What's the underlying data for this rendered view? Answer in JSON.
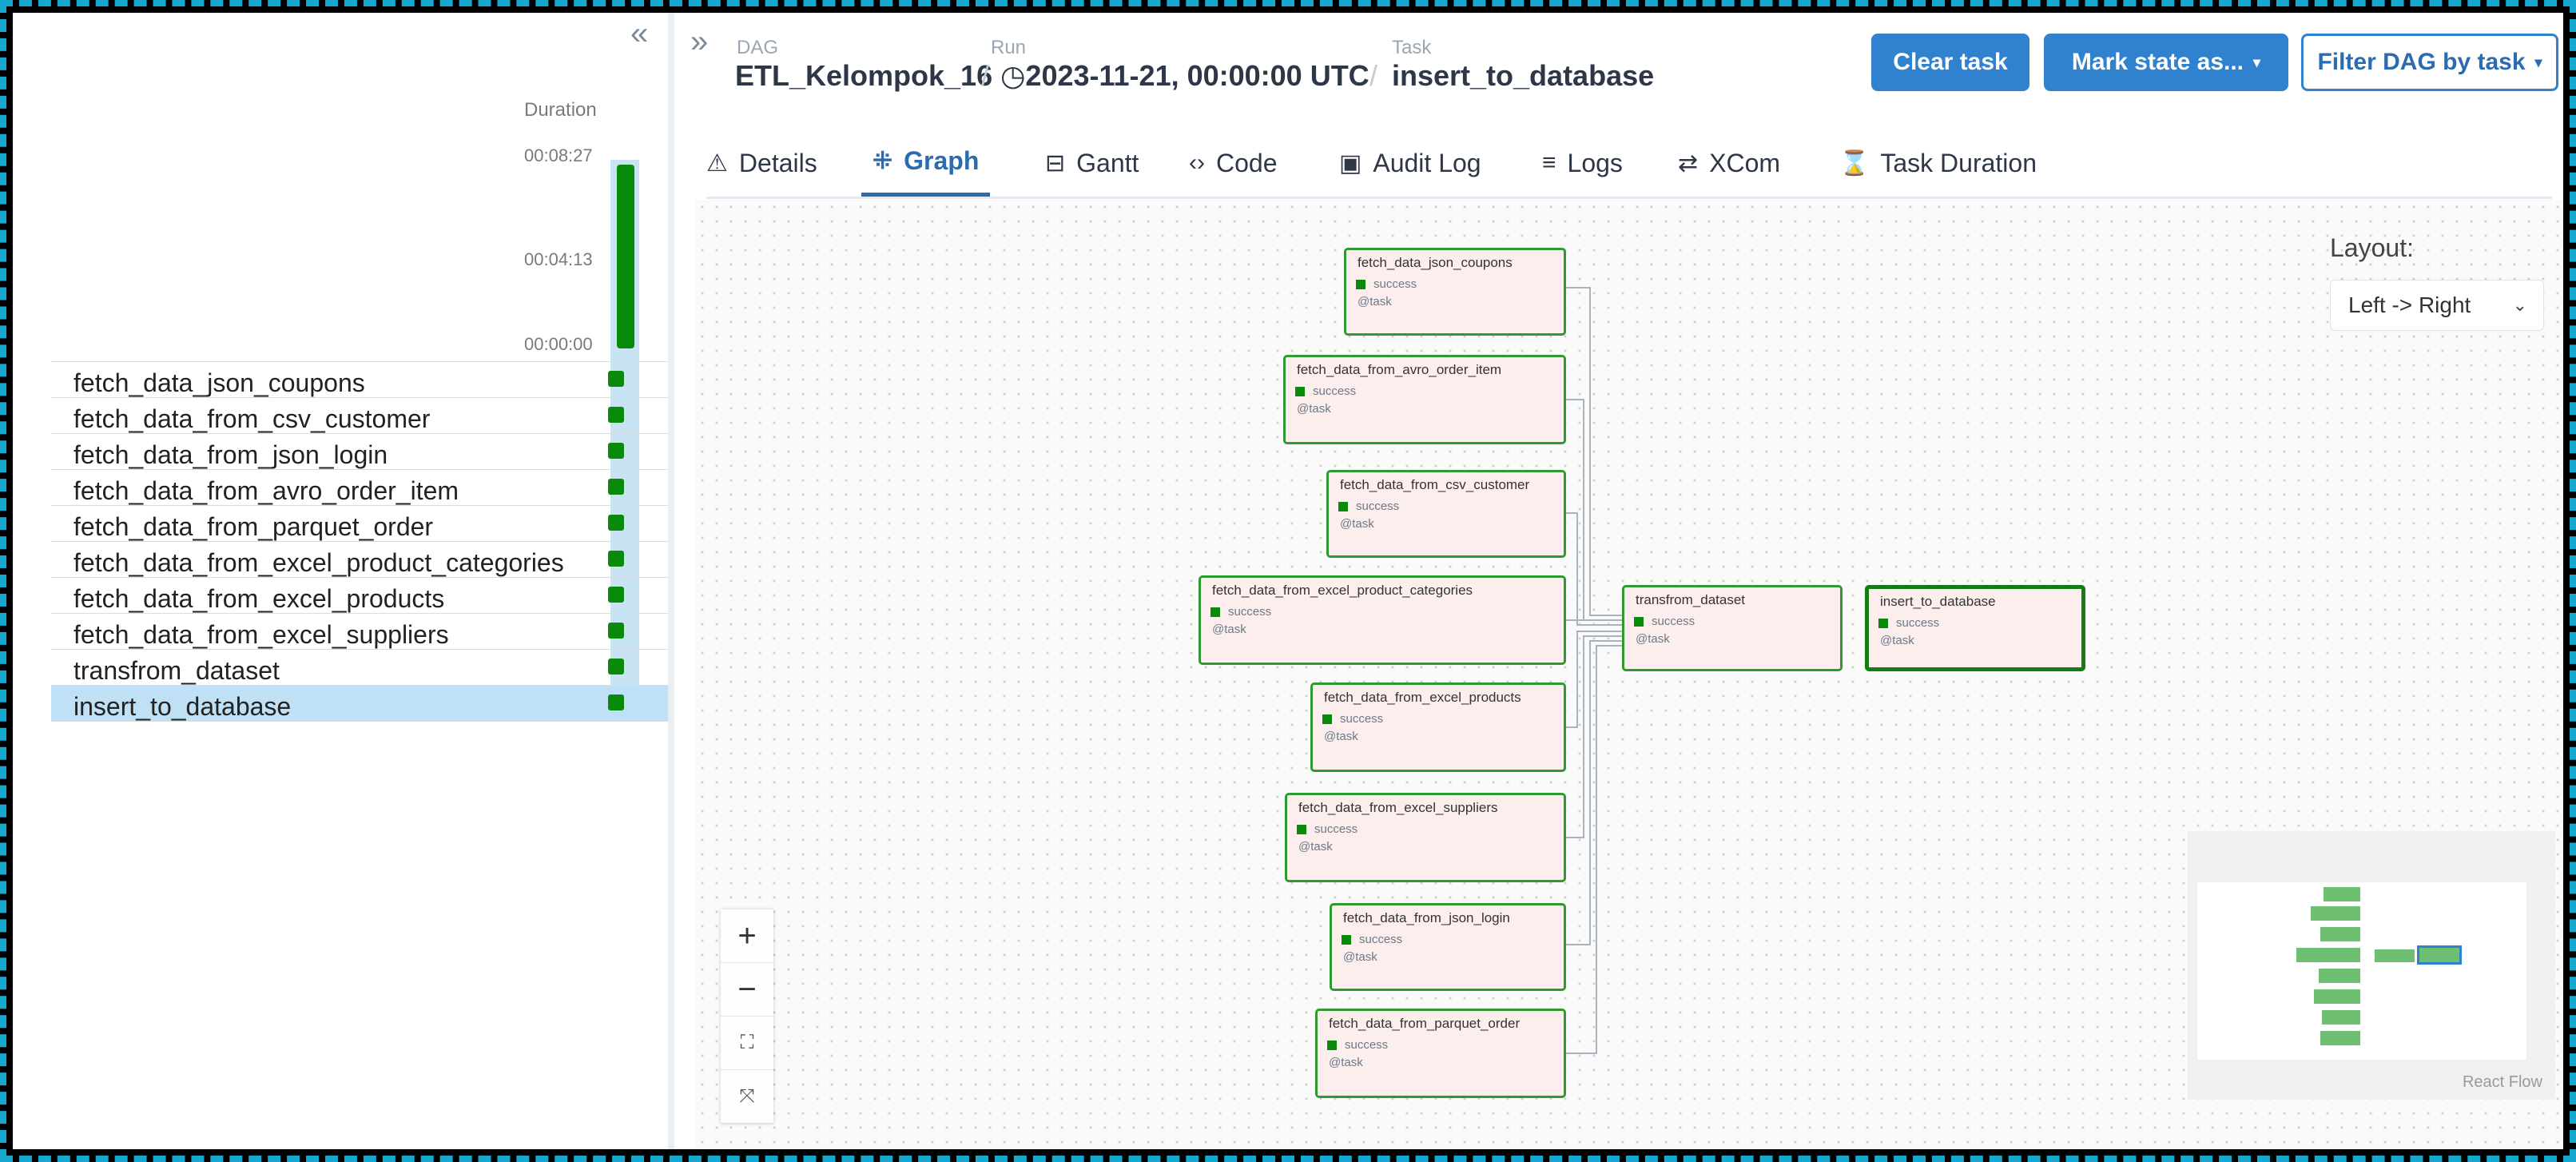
{
  "header": {
    "breadcrumbs": [
      {
        "label": "DAG",
        "value": "ETL_Kelompok_16"
      },
      {
        "label": "Run",
        "value": "2023-11-21, 00:00:00 UTC"
      },
      {
        "label": "Task",
        "value": "insert_to_database"
      }
    ],
    "buttons": {
      "clear_task": "Clear task",
      "mark_state": "Mark state as...",
      "filter_dag": "Filter DAG by task"
    }
  },
  "tabs": [
    {
      "label": "Details",
      "icon": "warning-triangle-icon"
    },
    {
      "label": "Graph",
      "icon": "graph-icon",
      "active": true
    },
    {
      "label": "Gantt",
      "icon": "gantt-icon"
    },
    {
      "label": "Code",
      "icon": "code-icon"
    },
    {
      "label": "Audit Log",
      "icon": "document-icon"
    },
    {
      "label": "Logs",
      "icon": "list-icon"
    },
    {
      "label": "XCom",
      "icon": "swap-icon"
    },
    {
      "label": "Task Duration",
      "icon": "hourglass-icon"
    }
  ],
  "left_panel": {
    "duration_label": "Duration",
    "ticks": [
      "00:08:27",
      "00:04:13",
      "00:00:00"
    ],
    "tasks": [
      {
        "name": "fetch_data_json_coupons",
        "state": "success"
      },
      {
        "name": "fetch_data_from_csv_customer",
        "state": "success"
      },
      {
        "name": "fetch_data_from_json_login",
        "state": "success"
      },
      {
        "name": "fetch_data_from_avro_order_item",
        "state": "success"
      },
      {
        "name": "fetch_data_from_parquet_order",
        "state": "success"
      },
      {
        "name": "fetch_data_from_excel_product_categories",
        "state": "success"
      },
      {
        "name": "fetch_data_from_excel_products",
        "state": "success"
      },
      {
        "name": "fetch_data_from_excel_suppliers",
        "state": "success"
      },
      {
        "name": "transfrom_dataset",
        "state": "success"
      },
      {
        "name": "insert_to_database",
        "state": "success",
        "selected": true
      }
    ]
  },
  "graph": {
    "nodes": [
      {
        "title": "fetch_data_json_coupons",
        "status": "success",
        "operator": "@task"
      },
      {
        "title": "fetch_data_from_avro_order_item",
        "status": "success",
        "operator": "@task"
      },
      {
        "title": "fetch_data_from_csv_customer",
        "status": "success",
        "operator": "@task"
      },
      {
        "title": "fetch_data_from_excel_product_categories",
        "status": "success",
        "operator": "@task"
      },
      {
        "title": "fetch_data_from_excel_products",
        "status": "success",
        "operator": "@task"
      },
      {
        "title": "fetch_data_from_excel_suppliers",
        "status": "success",
        "operator": "@task"
      },
      {
        "title": "fetch_data_from_json_login",
        "status": "success",
        "operator": "@task"
      },
      {
        "title": "fetch_data_from_parquet_order",
        "status": "success",
        "operator": "@task"
      },
      {
        "title": "transfrom_dataset",
        "status": "success",
        "operator": "@task"
      },
      {
        "title": "insert_to_database",
        "status": "success",
        "operator": "@task",
        "selected": true
      }
    ],
    "layout_label": "Layout:",
    "layout_value": "Left -> Right",
    "controls": {
      "zoom_in": "+",
      "zoom_out": "−"
    },
    "attribution": "React Flow"
  },
  "colors": {
    "success": "#008000",
    "accent": "#3182ce",
    "node_fill": "#fdeeee"
  }
}
